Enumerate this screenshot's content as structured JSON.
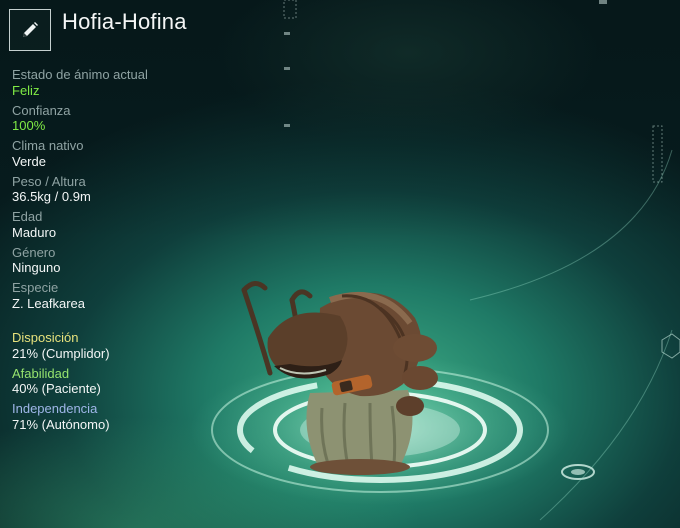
{
  "creature": {
    "name": "Hofia-Hofina"
  },
  "stats": [
    {
      "label": "Estado de ánimo actual",
      "value": "Feliz"
    },
    {
      "label": "Confianza",
      "value": "100%"
    },
    {
      "label": "Clima nativo",
      "value": "Verde"
    },
    {
      "label": "Peso / Altura",
      "value": "36.5kg / 0.9m"
    },
    {
      "label": "Edad",
      "value": "Maduro"
    },
    {
      "label": "Género",
      "value": "Ninguno"
    },
    {
      "label": "Especie",
      "value": "Z. Leafkarea"
    }
  ],
  "traits": [
    {
      "label": "Disposición",
      "value": "21% (Cumplidor)"
    },
    {
      "label": "Afabilidad",
      "value": "40% (Paciente)"
    },
    {
      "label": "Independencia",
      "value": "71% (Autónomo)"
    }
  ],
  "colors": {
    "highlight_value": "#7fea45",
    "disposition": "#e7e27c",
    "affability": "#96e46e",
    "independence": "#9fb6e8"
  },
  "icons": {
    "edit": "pencil-icon"
  }
}
